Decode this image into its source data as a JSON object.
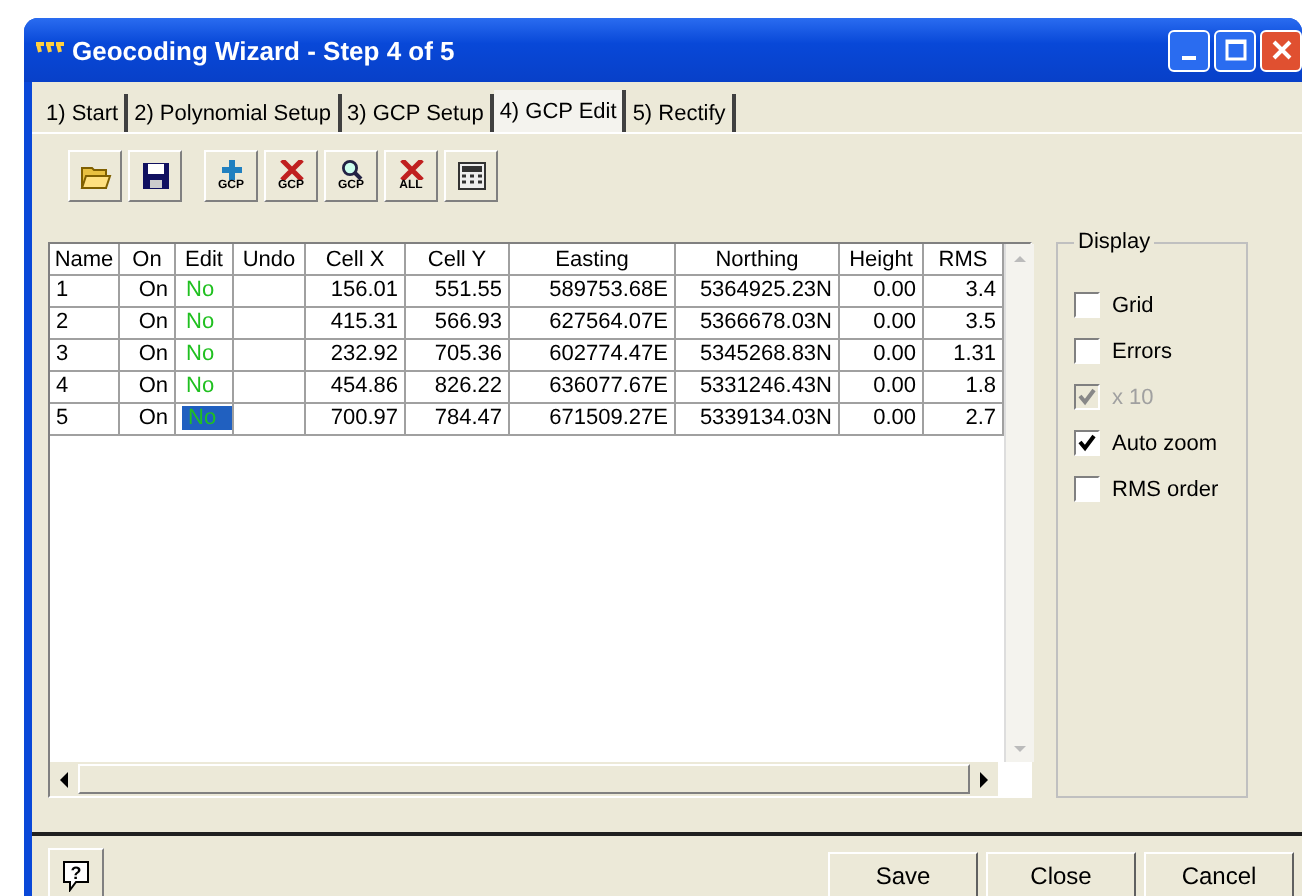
{
  "window": {
    "title": "Geocoding Wizard - Step 4 of 5"
  },
  "tabs": [
    {
      "label": "1) Start",
      "selected": false
    },
    {
      "label": "2) Polynomial Setup",
      "selected": false
    },
    {
      "label": "3) GCP Setup",
      "selected": false
    },
    {
      "label": "4) GCP Edit",
      "selected": true
    },
    {
      "label": "5) Rectify",
      "selected": false
    }
  ],
  "toolbar": [
    {
      "kind": "open"
    },
    {
      "kind": "save"
    },
    {
      "kind": "add",
      "caption": "GCP"
    },
    {
      "kind": "delete",
      "caption": "GCP"
    },
    {
      "kind": "find",
      "caption": "GCP"
    },
    {
      "kind": "delete",
      "caption": "ALL"
    },
    {
      "kind": "calc"
    }
  ],
  "table": {
    "columns": [
      "Name",
      "On",
      "Edit",
      "Undo",
      "Cell X",
      "Cell Y",
      "Easting",
      "Northing",
      "Height",
      "RMS"
    ],
    "rows": [
      {
        "cells": [
          "1",
          "On",
          "No",
          "",
          "156.01",
          "551.55",
          "589753.68E",
          "5364925.23N",
          "0.00",
          "3.4"
        ],
        "selected": false
      },
      {
        "cells": [
          "2",
          "On",
          "No",
          "",
          "415.31",
          "566.93",
          "627564.07E",
          "5366678.03N",
          "0.00",
          "3.5"
        ],
        "selected": false
      },
      {
        "cells": [
          "3",
          "On",
          "No",
          "",
          "232.92",
          "705.36",
          "602774.47E",
          "5345268.83N",
          "0.00",
          "1.31"
        ],
        "selected": false
      },
      {
        "cells": [
          "4",
          "On",
          "No",
          "",
          "454.86",
          "826.22",
          "636077.67E",
          "5331246.43N",
          "0.00",
          "1.8"
        ],
        "selected": false
      },
      {
        "cells": [
          "5",
          "On",
          "No",
          "",
          "700.97",
          "784.47",
          "671509.27E",
          "5339134.03N",
          "0.00",
          "2.7"
        ],
        "selected": true
      }
    ]
  },
  "display": {
    "title": "Display",
    "options": [
      {
        "label": "Grid",
        "checked": false,
        "disabled": false
      },
      {
        "label": "Errors",
        "checked": false,
        "disabled": false
      },
      {
        "label": "x 10",
        "checked": true,
        "disabled": true
      },
      {
        "label": "Auto zoom",
        "checked": true,
        "disabled": false
      },
      {
        "label": "RMS order",
        "checked": false,
        "disabled": false
      }
    ]
  },
  "help": {
    "label": "?"
  },
  "buttons": [
    "Save",
    "Close",
    "Cancel"
  ]
}
